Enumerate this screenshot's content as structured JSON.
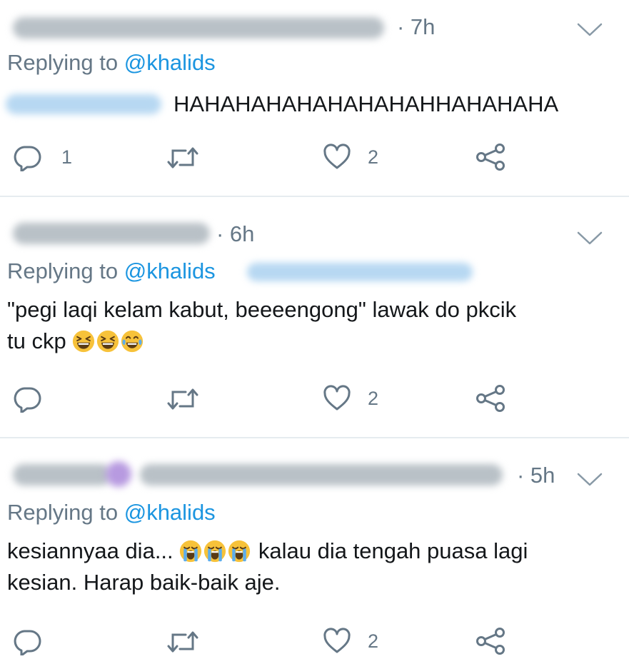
{
  "tweets": [
    {
      "time": "· 7h",
      "replying_prefix": "Replying to ",
      "handle": "@khalids",
      "text_lines": [
        "HAHAHAHAHAHAHAHAHHAHAHAHA"
      ],
      "reply_count": "1",
      "like_count": "2"
    },
    {
      "time": "· 6h",
      "replying_prefix": "Replying to ",
      "handle": "@khalids",
      "text_lines": [
        "\"pegi laqi kelam kabut, beeeengong\" lawak do pkcik",
        "tu ckp"
      ],
      "emojis": [
        "grinning-squinting-face",
        "grinning-squinting-face",
        "face-with-tears-of-joy"
      ],
      "reply_count": "",
      "like_count": "2"
    },
    {
      "time": "· 5h",
      "replying_prefix": "Replying to ",
      "handle": "@khalids",
      "text_lines": [
        "kesiannyaa dia...",
        "kalau dia tengah puasa lagi",
        "kesian. Harap baik-baik aje."
      ],
      "emojis": [
        "loudly-crying-face",
        "loudly-crying-face",
        "loudly-crying-face"
      ],
      "reply_count": "",
      "like_count": "2"
    }
  ],
  "colors": {
    "secondary_text": "#657786",
    "link": "#1b95e0",
    "divider": "#e6ecf0",
    "emoji_yellow": "#f7c23a"
  }
}
